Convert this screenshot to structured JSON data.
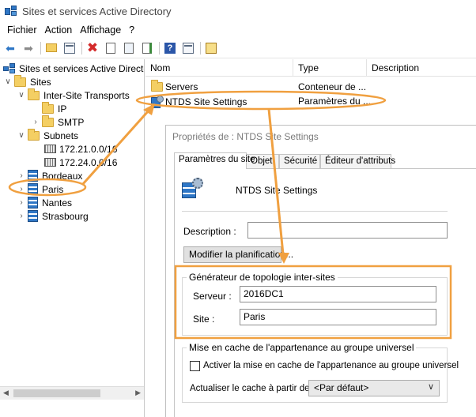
{
  "window": {
    "title": "Sites et services Active Directory"
  },
  "menu": [
    "Fichier",
    "Action",
    "Affichage",
    "?"
  ],
  "toolbar": {
    "icons": [
      "back-arrow-icon",
      "forward-arrow-icon",
      "up-folder-icon",
      "show-tree-icon",
      "delete-icon",
      "properties-icon",
      "refresh-icon",
      "export-list-icon",
      "help-icon",
      "console-icon",
      "run-icon"
    ]
  },
  "tree": {
    "root": "Sites et services Active Directory",
    "sites": "Sites",
    "inter_site": "Inter-Site Transports",
    "ip": "IP",
    "smtp": "SMTP",
    "subnets": "Subnets",
    "subnet1": "172.21.0.0/16",
    "subnet2": "172.24.0.0/16",
    "bordeaux": "Bordeaux",
    "paris": "Paris",
    "nantes": "Nantes",
    "strasbourg": "Strasbourg"
  },
  "list": {
    "columns": [
      "Nom",
      "Type",
      "Description"
    ],
    "rows": [
      {
        "name": "Servers",
        "type": "Conteneur de ..."
      },
      {
        "name": "NTDS Site Settings",
        "type": "Paramètres du ..."
      }
    ]
  },
  "dialog": {
    "title": "Propriétés de : NTDS Site Settings",
    "tabs": [
      "Paramètres du site",
      "Objet",
      "Sécurité",
      "Éditeur d'attributs"
    ],
    "object_name": "NTDS Site Settings",
    "description_label": "Description :",
    "description_value": "",
    "schedule_button": "Modifier la planification...",
    "topology_group": "Générateur de topologie inter-sites",
    "server_label": "Serveur :",
    "server_value": "2016DC1",
    "site_label": "Site :",
    "site_value": "Paris",
    "cache_group": "Mise en cache de l'appartenance au groupe universel",
    "cache_checkbox_label": "Activer la mise en cache de l'appartenance au groupe universel",
    "refresh_label": "Actualiser le cache à partir de :",
    "refresh_value": "<Par défaut>"
  },
  "colors": {
    "annotation_orange": "#f0a040",
    "folder_yellow": "#f4cf63",
    "site_blue": "#2f77c6"
  }
}
